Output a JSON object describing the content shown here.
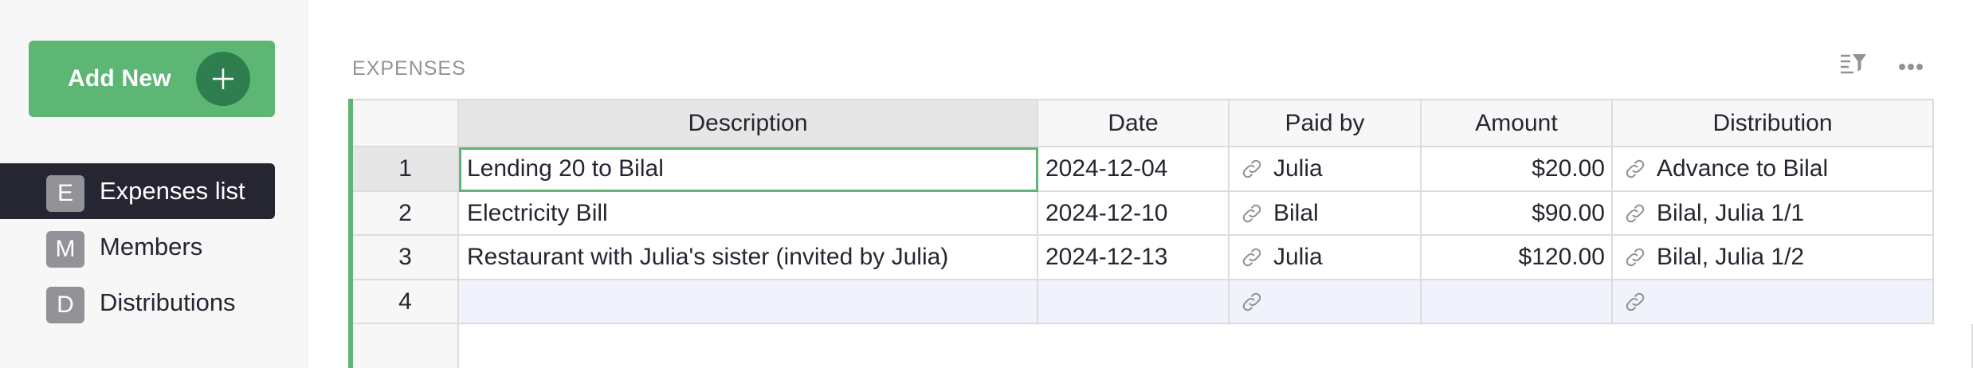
{
  "sidebar": {
    "add_new_label": "Add New",
    "pages": [
      {
        "badge": "E",
        "name": "Expenses list",
        "active": true
      },
      {
        "badge": "M",
        "name": "Members",
        "active": false
      },
      {
        "badge": "D",
        "name": "Distributions",
        "active": false
      }
    ]
  },
  "section": {
    "title": "EXPENSES",
    "sort_filter_icon": "sort-filter-icon",
    "menu_icon": "more-options-icon"
  },
  "table": {
    "columns": [
      "Description",
      "Date",
      "Paid by",
      "Amount",
      "Distribution"
    ],
    "rows": [
      {
        "num": "1",
        "description": "Lending 20 to Bilal",
        "date": "2024-12-04",
        "paid_by": "Julia",
        "amount": "$20.00",
        "distribution": "Advance to Bilal"
      },
      {
        "num": "2",
        "description": "Electricity Bill",
        "date": "2024-12-10",
        "paid_by": "Bilal",
        "amount": "$90.00",
        "distribution": "Bilal, Julia 1/1"
      },
      {
        "num": "3",
        "description": "Restaurant with Julia's sister (invited by Julia)",
        "date": "2024-12-13",
        "paid_by": "Julia",
        "amount": "$120.00",
        "distribution": "Bilal, Julia 1/2"
      }
    ],
    "new_row_num": "4"
  },
  "colors": {
    "accent": "#5eb675",
    "accent_dark": "#2f7e4f",
    "active_page_bg": "#262633",
    "new_row_bg": "#f0f3fb"
  }
}
